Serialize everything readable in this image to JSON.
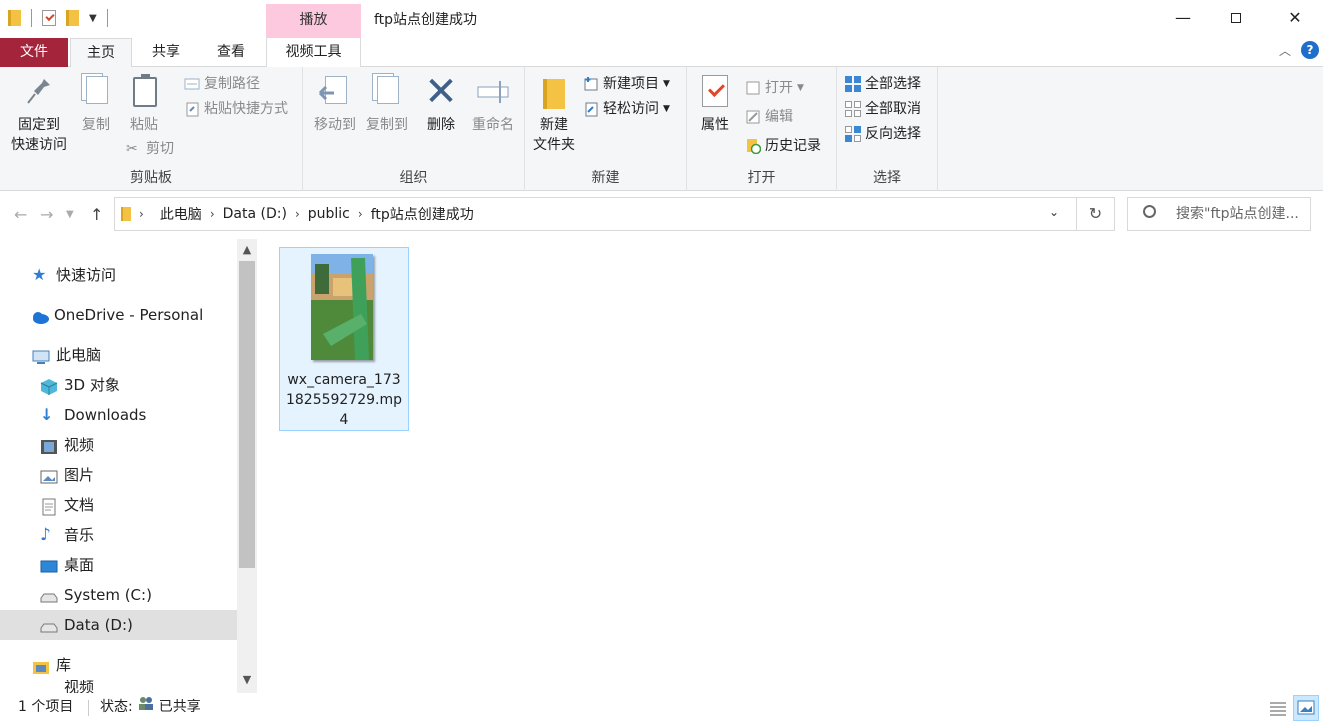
{
  "window": {
    "title": "ftp站点创建成功",
    "context_tab_top": "播放"
  },
  "tabs": {
    "file": "文件",
    "home": "主页",
    "share": "共享",
    "view": "查看",
    "video_tools": "视频工具"
  },
  "ribbon": {
    "clipboard": {
      "label": "剪贴板",
      "pin_line1": "固定到",
      "pin_line2": "快速访问",
      "copy": "复制",
      "paste": "粘贴",
      "copy_path": "复制路径",
      "paste_shortcut": "粘贴快捷方式",
      "cut": "剪切"
    },
    "organize": {
      "label": "组织",
      "move_to": "移动到",
      "copy_to": "复制到",
      "delete": "删除",
      "rename": "重命名"
    },
    "new": {
      "label": "新建",
      "new_folder_line1": "新建",
      "new_folder_line2": "文件夹",
      "new_item": "新建项目",
      "easy_access": "轻松访问"
    },
    "open": {
      "label": "打开",
      "properties": "属性",
      "open": "打开",
      "edit": "编辑",
      "history": "历史记录"
    },
    "select": {
      "label": "选择",
      "select_all": "全部选择",
      "select_none": "全部取消",
      "invert": "反向选择"
    }
  },
  "address": {
    "crumbs": [
      "此电脑",
      "Data (D:)",
      "public",
      "ftp站点创建成功"
    ],
    "search_placeholder": "搜索\"ftp站点创建..."
  },
  "nav": {
    "quick_access": "快速访问",
    "onedrive": "OneDrive - Personal",
    "this_pc": "此电脑",
    "objects3d": "3D 对象",
    "downloads": "Downloads",
    "videos": "视频",
    "pictures": "图片",
    "documents": "文档",
    "music": "音乐",
    "desktop": "桌面",
    "system_c": "System (C:)",
    "data_d": "Data (D:)",
    "libraries": "库",
    "partial": "视频"
  },
  "files": [
    {
      "name": "wx_camera_1731825592729.mp4"
    }
  ],
  "status": {
    "count": "1 个项目",
    "state_label": "状态:",
    "state_value": "已共享"
  },
  "colors": {
    "file_tab": "#a4243b",
    "context_tab": "#fcc9de",
    "selection": "#e5f3ff",
    "accent_blue": "#1e6fcc"
  }
}
